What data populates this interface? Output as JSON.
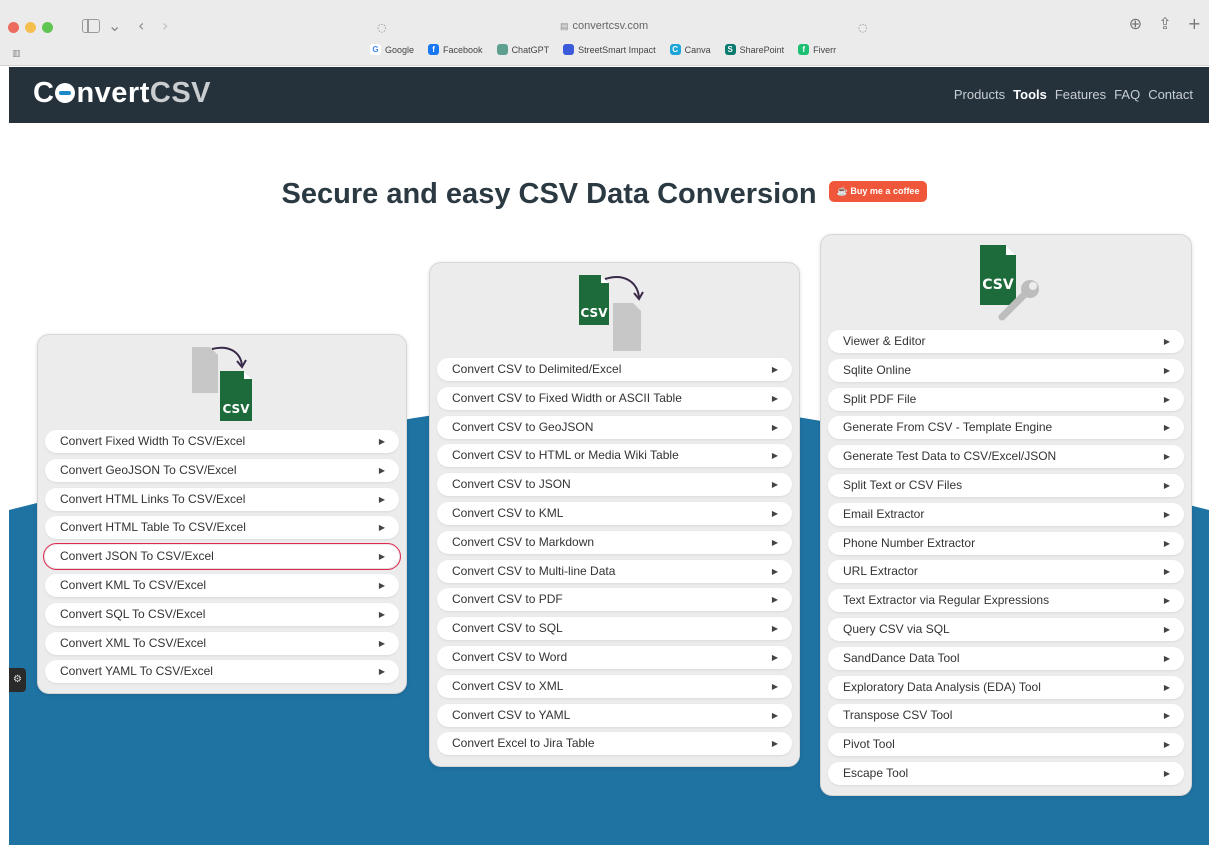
{
  "browser": {
    "address": "convertcsv.com",
    "bookmarks": [
      {
        "label": "Google",
        "color": "#ffffff",
        "glyph": "G"
      },
      {
        "label": "Facebook",
        "color": "#1877f2",
        "glyph": "f"
      },
      {
        "label": "ChatGPT",
        "color": "#5f9f8f",
        "glyph": ""
      },
      {
        "label": "StreetSmart Impact",
        "color": "#3b5bdb",
        "glyph": ""
      },
      {
        "label": "Canva",
        "color": "#1ba5d8",
        "glyph": "C"
      },
      {
        "label": "SharePoint",
        "color": "#087a6e",
        "glyph": "S"
      },
      {
        "label": "Fiverr",
        "color": "#1dbf73",
        "glyph": "f"
      }
    ]
  },
  "header": {
    "logo_prefix": "C",
    "logo_mid": "nvert",
    "logo_csv": "CSV",
    "nav": [
      {
        "label": "Products",
        "active": false
      },
      {
        "label": "Tools",
        "active": true
      },
      {
        "label": "Features",
        "active": false
      },
      {
        "label": "FAQ",
        "active": false
      },
      {
        "label": "Contact",
        "active": false
      }
    ]
  },
  "hero": {
    "title": "Secure and easy CSV Data Conversion",
    "coffee_label": "Buy me a coffee"
  },
  "colors": {
    "header_bg": "#25323c",
    "wave": "#1f73a3",
    "csv_green": "#1d6b3a",
    "highlight": "#e0284f"
  },
  "cards": {
    "to_csv": {
      "icon_label": "CSV",
      "items": [
        "Convert Fixed Width To CSV/Excel",
        "Convert GeoJSON To CSV/Excel",
        "Convert HTML Links To CSV/Excel",
        "Convert HTML Table To CSV/Excel",
        "Convert JSON To CSV/Excel",
        "Convert KML To CSV/Excel",
        "Convert SQL To CSV/Excel",
        "Convert XML To CSV/Excel",
        "Convert YAML To CSV/Excel"
      ],
      "highlighted_index": 4
    },
    "from_csv": {
      "icon_label": "CSV",
      "items": [
        "Convert CSV to Delimited/Excel",
        "Convert CSV to Fixed Width or ASCII Table",
        "Convert CSV to GeoJSON",
        "Convert CSV to HTML or Media Wiki Table",
        "Convert CSV to JSON",
        "Convert CSV to KML",
        "Convert CSV to Markdown",
        "Convert CSV to Multi-line Data",
        "Convert CSV to PDF",
        "Convert CSV to SQL",
        "Convert CSV to Word",
        "Convert CSV to XML",
        "Convert CSV to YAML",
        "Convert Excel to Jira Table"
      ]
    },
    "tools": {
      "icon_label": "CSV",
      "items": [
        "Viewer & Editor",
        "Sqlite Online",
        "Split PDF File",
        "Generate From CSV - Template Engine",
        "Generate Test Data to CSV/Excel/JSON",
        "Split Text or CSV Files",
        "Email Extractor",
        "Phone Number Extractor",
        "URL Extractor",
        "Text Extractor via Regular Expressions",
        "Query CSV via SQL",
        "SandDance Data Tool",
        "Exploratory Data Analysis (EDA) Tool",
        "Transpose CSV Tool",
        "Pivot Tool",
        "Escape Tool"
      ]
    }
  }
}
